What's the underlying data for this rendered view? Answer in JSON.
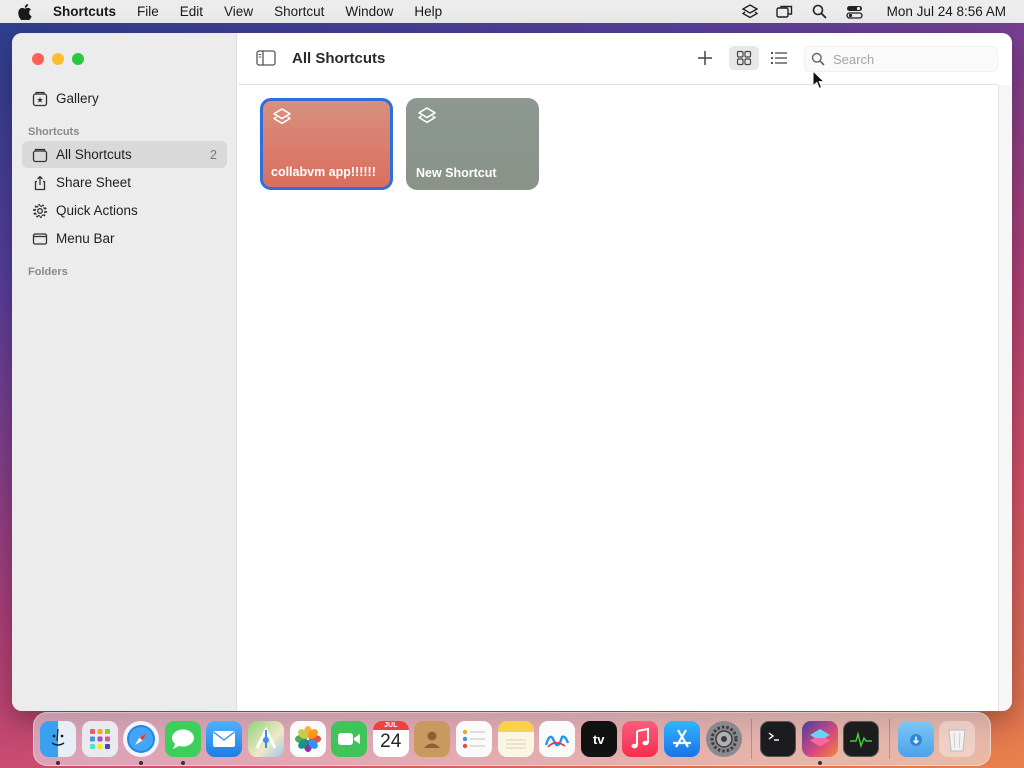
{
  "menubar": {
    "app_name": "Shortcuts",
    "menus": [
      "File",
      "Edit",
      "View",
      "Shortcut",
      "Window",
      "Help"
    ],
    "clock": "Mon Jul 24  8:56 AM"
  },
  "sidebar": {
    "gallery": "Gallery",
    "shortcuts_section": "Shortcuts",
    "items": [
      {
        "label": "All Shortcuts",
        "count": "2"
      },
      {
        "label": "Share Sheet"
      },
      {
        "label": "Quick Actions"
      },
      {
        "label": "Menu Bar"
      }
    ],
    "folders_section": "Folders"
  },
  "toolbar": {
    "title": "All Shortcuts",
    "search_placeholder": "Search"
  },
  "shortcuts": [
    {
      "label": "collabvm app!!!!!!",
      "color": "#db7a68"
    },
    {
      "label": "New Shortcut",
      "color": "#8b958c"
    }
  ],
  "dock": {
    "calendar_month": "JUL",
    "calendar_day": "24",
    "tv_label": "tv"
  }
}
